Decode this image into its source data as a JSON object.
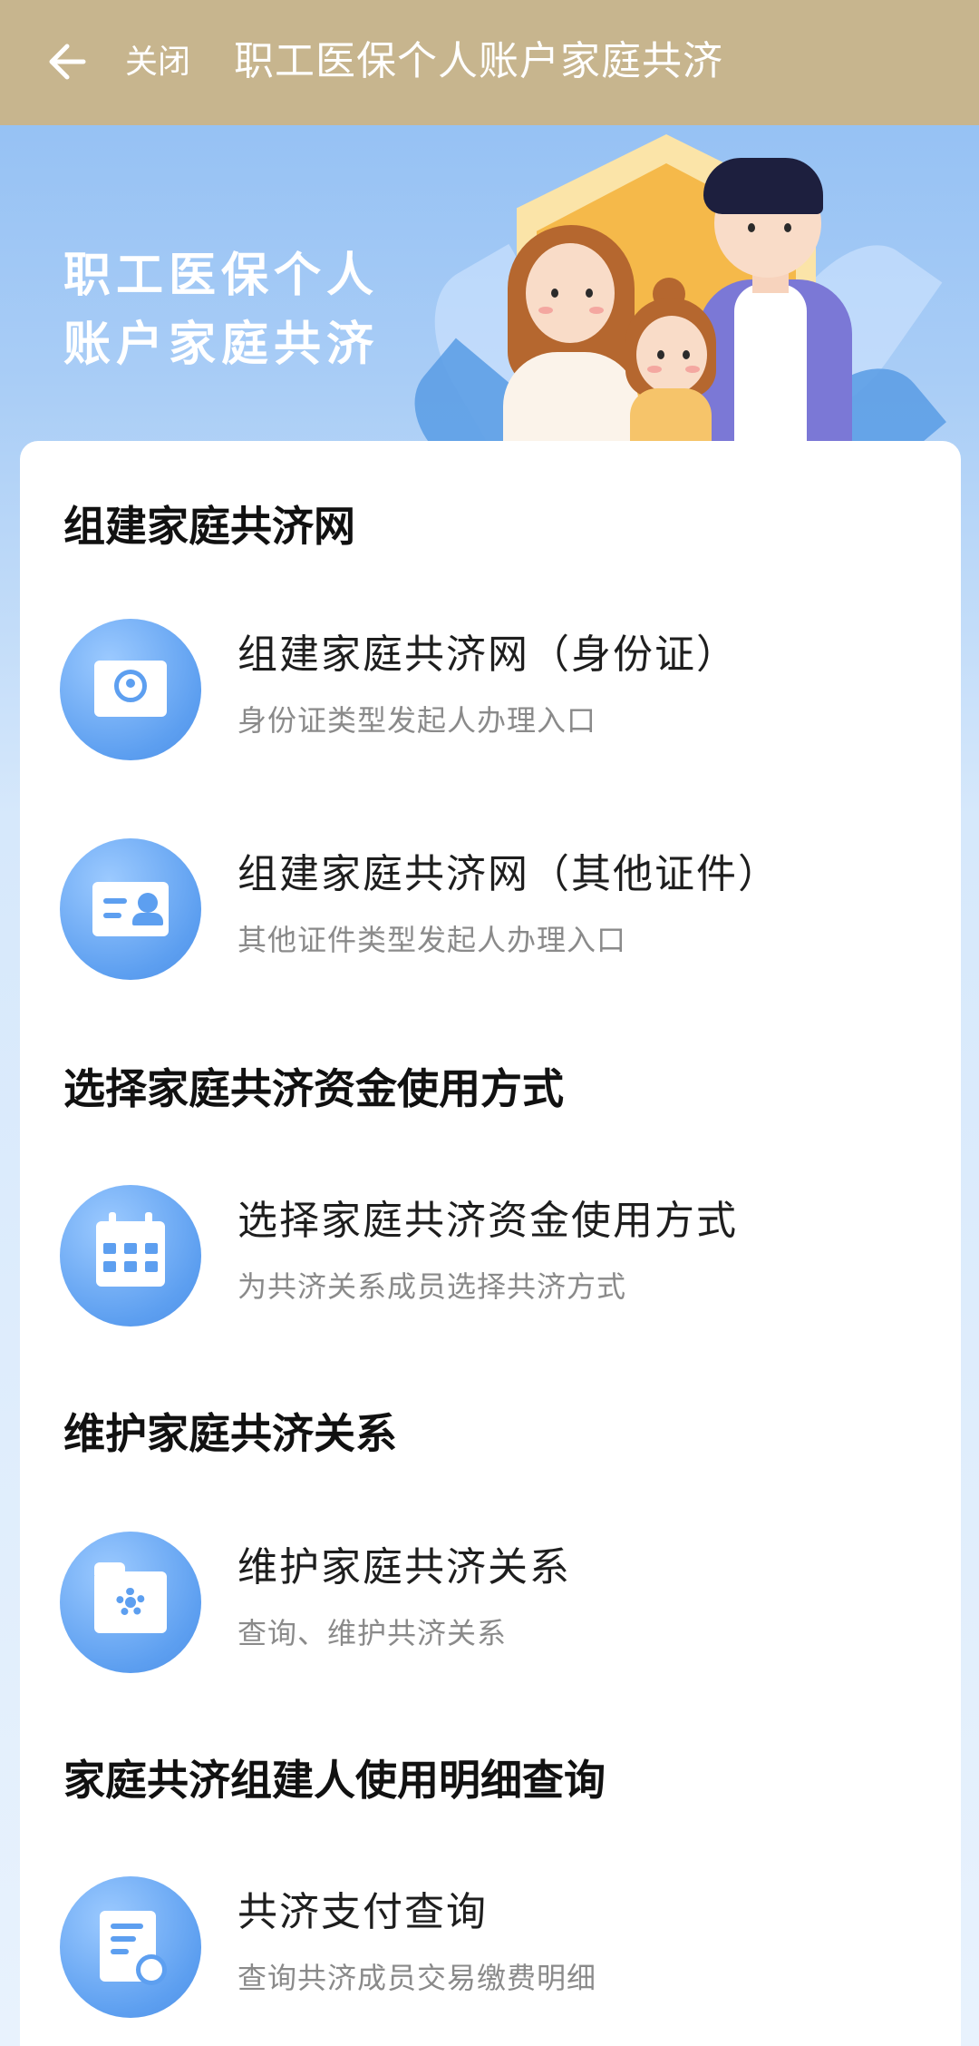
{
  "header": {
    "back_icon": "arrow-left-icon",
    "close_label": "关闭",
    "title": "职工医保个人账户家庭共济"
  },
  "hero": {
    "heading_line1": "职工医保个人",
    "heading_line2": "账户家庭共济",
    "illustration": "family-illustration"
  },
  "colors": {
    "header_bg": "#c7b58e",
    "hero_bg": "#8dbcf3",
    "icon_bg": "#5d9ff0",
    "title_text": "#1e1e1e",
    "subtitle_text": "#8a8a8a"
  },
  "sections": [
    {
      "title": "组建家庭共济网",
      "entries": [
        {
          "icon": "id-card-icon",
          "title": "组建家庭共济网（身份证）",
          "subtitle": "身份证类型发起人办理入口"
        },
        {
          "icon": "contact-card-icon",
          "title": "组建家庭共济网（其他证件）",
          "subtitle": "其他证件类型发起人办理入口"
        }
      ]
    },
    {
      "title": "选择家庭共济资金使用方式",
      "entries": [
        {
          "icon": "calendar-icon",
          "title": "选择家庭共济资金使用方式",
          "subtitle": "为共济关系成员选择共济方式"
        }
      ]
    },
    {
      "title": "维护家庭共济关系",
      "entries": [
        {
          "icon": "folder-settings-icon",
          "title": "维护家庭共济关系",
          "subtitle": "查询、维护共济关系"
        }
      ]
    },
    {
      "title": "家庭共济组建人使用明细查询",
      "entries": [
        {
          "icon": "document-icon",
          "title": "共济支付查询",
          "subtitle": "查询共济成员交易缴费明细"
        }
      ]
    }
  ]
}
